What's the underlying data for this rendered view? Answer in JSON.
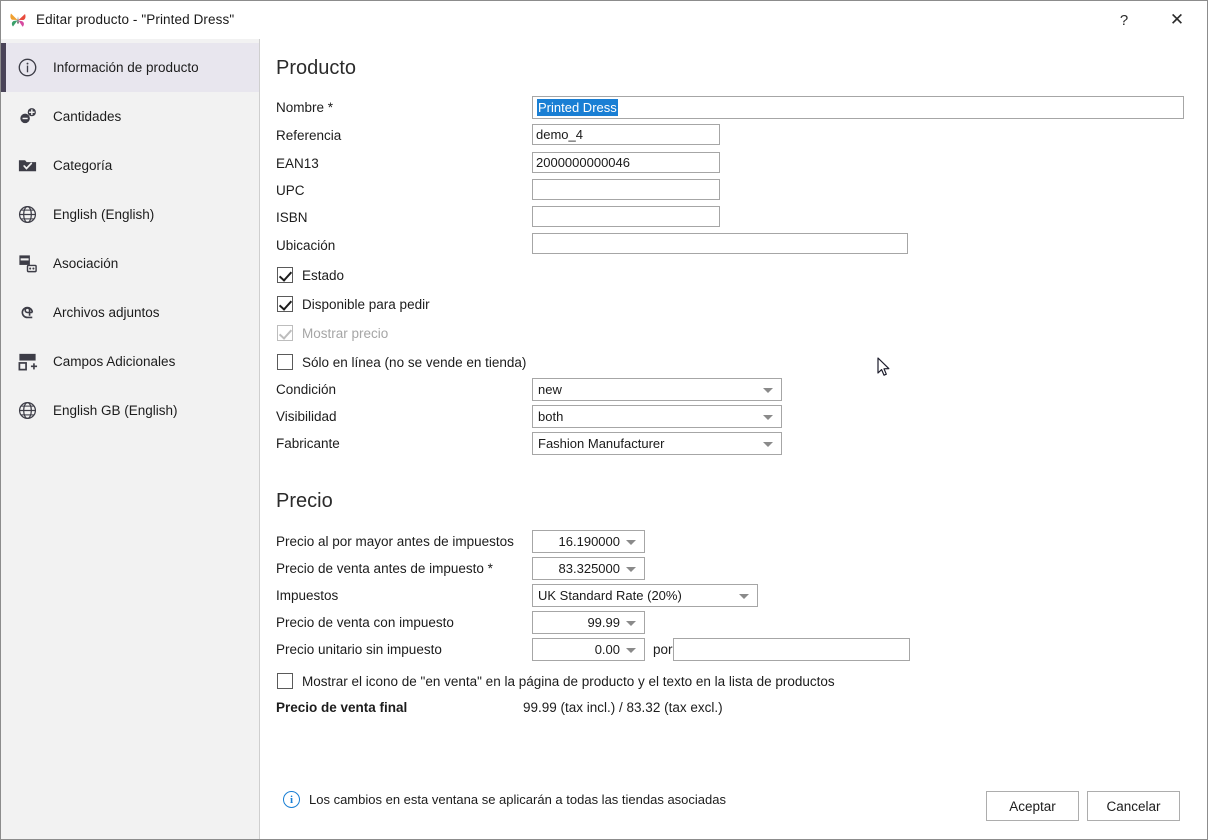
{
  "window": {
    "title": "Editar producto - \"Printed Dress\"",
    "app_icon": "butterfly-icon",
    "help_label": "?",
    "close_label": "✕"
  },
  "sidebar": {
    "items": [
      {
        "label": "Información de producto",
        "icon": "info-circle-icon",
        "active": true
      },
      {
        "label": "Cantidades",
        "icon": "quantities-icon",
        "active": false
      },
      {
        "label": "Categoría",
        "icon": "folder-check-icon",
        "active": false
      },
      {
        "label": "English (English)",
        "icon": "globe-icon",
        "active": false
      },
      {
        "label": "Asociación",
        "icon": "association-icon",
        "active": false
      },
      {
        "label": "Archivos adjuntos",
        "icon": "paperclip-icon",
        "active": false
      },
      {
        "label": "Campos Adicionales",
        "icon": "additional-fields-icon",
        "active": false
      },
      {
        "label": "English GB (English)",
        "icon": "globe-icon",
        "active": false
      }
    ]
  },
  "product_section": {
    "title": "Producto",
    "fields": {
      "nombre": {
        "label": "Nombre *",
        "value": "Printed Dress",
        "selected": true
      },
      "referencia": {
        "label": "Referencia",
        "value": "demo_4"
      },
      "ean13": {
        "label": "EAN13",
        "value": "2000000000046"
      },
      "upc": {
        "label": "UPC",
        "value": ""
      },
      "isbn": {
        "label": "ISBN",
        "value": ""
      },
      "ubicacion": {
        "label": "Ubicación",
        "value": ""
      }
    },
    "checkboxes": [
      {
        "label": "Estado",
        "checked": true,
        "disabled": false
      },
      {
        "label": "Disponible para pedir",
        "checked": true,
        "disabled": false
      },
      {
        "label": "Mostrar precio",
        "checked": true,
        "disabled": true
      },
      {
        "label": "Sólo en línea (no se vende en tienda)",
        "checked": false,
        "disabled": false
      }
    ],
    "selects": {
      "condicion": {
        "label": "Condición",
        "value": "new"
      },
      "visibilidad": {
        "label": "Visibilidad",
        "value": "both"
      },
      "fabricante": {
        "label": "Fabricante",
        "value": "Fashion Manufacturer"
      }
    }
  },
  "price_section": {
    "title": "Precio",
    "wholesale": {
      "label": "Precio al por mayor antes de impuestos",
      "value": "16.190000"
    },
    "retail_excl": {
      "label": "Precio de venta antes de impuesto *",
      "value": "83.325000"
    },
    "tax": {
      "label": "Impuestos",
      "value": "UK Standard Rate (20%)"
    },
    "retail_incl": {
      "label": "Precio de venta con impuesto",
      "value": "99.99"
    },
    "unit_price": {
      "label": "Precio unitario sin impuesto",
      "value": "0.00",
      "per_label": "por",
      "per_value": ""
    },
    "on_sale_checkbox": {
      "label": "Mostrar el icono de \"en venta\" en la página de producto y el texto en la lista de productos",
      "checked": false
    },
    "final_price": {
      "label": "Precio de venta final",
      "value": "99.99 (tax incl.) / 83.32 (tax excl.)"
    }
  },
  "footer": {
    "note": "Los cambios en esta ventana se aplicarán a todas las tiendas asociadas",
    "info_icon": "info-circle-icon",
    "accept_label": "Aceptar",
    "cancel_label": "Cancelar"
  },
  "colors": {
    "accent_selection": "#1a7fd4",
    "sidebar_bg": "#f2f2f2",
    "sidebar_active_bg": "#e8e6ee",
    "sidebar_active_bar": "#4a4458",
    "info_blue": "#1a7fd4"
  }
}
